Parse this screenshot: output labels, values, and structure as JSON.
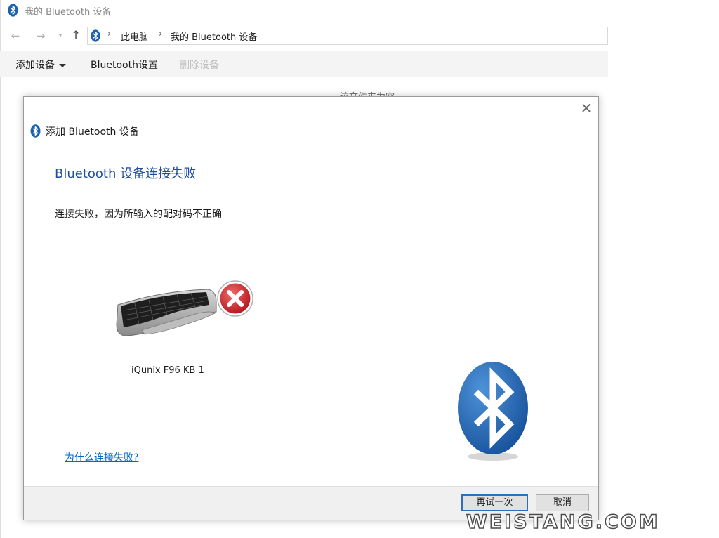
{
  "window": {
    "title": "我的 Bluetooth 设备"
  },
  "navigation": {
    "breadcrumb": [
      "此电脑",
      "我的 Bluetooth 设备"
    ],
    "separator": "›"
  },
  "ribbon": {
    "add_device": "添加设备",
    "bluetooth_settings": "Bluetooth设置",
    "remove_device": "删除设备"
  },
  "folder_empty_text": "该文件夹为空",
  "dialog": {
    "title": "添加 Bluetooth 设备",
    "heading": "Bluetooth 设备连接失败",
    "message": "连接失败，因为所输入的配对码不正确",
    "device_name": "iQunix F96 KB 1",
    "help_link": "为什么连接失败?",
    "retry_button": "再试一次",
    "cancel_button": "取消"
  },
  "watermark": "WEISTANG.COM",
  "colors": {
    "heading": "#1f4e9c",
    "link": "#0066cc",
    "bluetooth": "#1d62b0",
    "error": "#c9252c"
  },
  "icons": {
    "bluetooth": "bluetooth-icon",
    "error": "error-x-icon",
    "close": "close-icon",
    "keyboard": "keyboard-icon"
  }
}
